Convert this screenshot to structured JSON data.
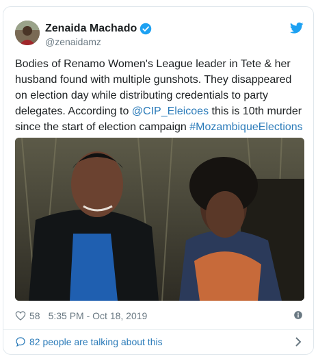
{
  "author": {
    "display_name": "Zenaida Machado",
    "handle": "@zenaidamz",
    "verified_icon": "verified-badge-icon",
    "avatar": "avatar"
  },
  "brand": {
    "logo_icon": "twitter-bird-icon",
    "accent_color": "#1da1f2",
    "link_color": "#2b7bb9"
  },
  "tweet": {
    "text_part1": "Bodies of Renamo Women's League leader in Tete & her husband found with multiple gunshots. They disappeared on election day while distributing credentials to party delegates. According to ",
    "mention": "@CIP_Eleicoes",
    "text_part2": " this is 10th murder since the start of election campaign ",
    "hashtag": "#MozambiqueElections"
  },
  "meta": {
    "likes": "58",
    "timestamp": "5:35 PM - Oct 18, 2019",
    "heart_icon": "heart-icon",
    "info_icon": "info-icon"
  },
  "footer": {
    "talking_label": "82 people are talking about this",
    "bubble_icon": "speech-bubble-icon",
    "chevron_icon": "chevron-right-icon"
  }
}
